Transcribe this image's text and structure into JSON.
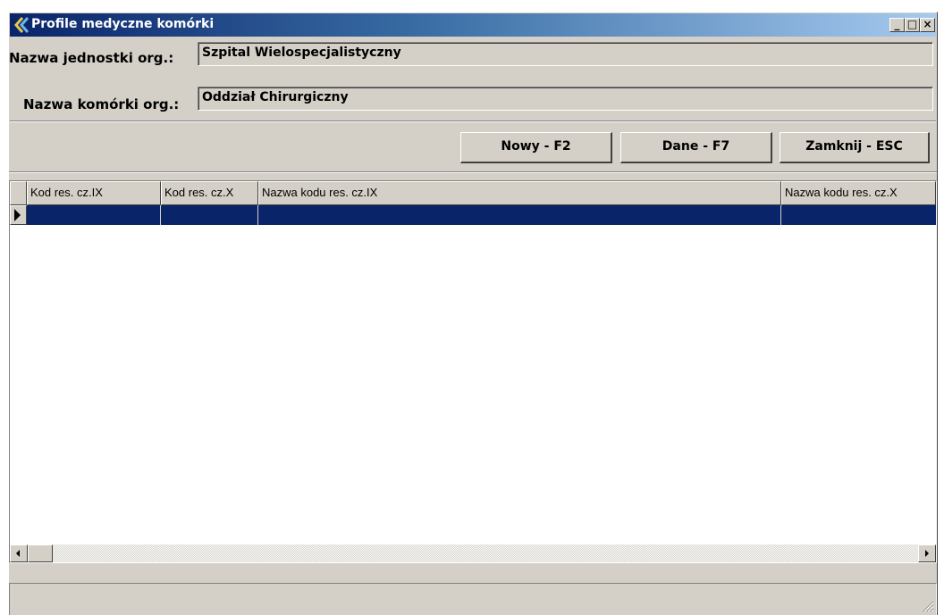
{
  "window": {
    "title": "Profile medyczne komórki",
    "minimize": "_",
    "maximize": "□",
    "close": "×"
  },
  "form": {
    "unit_label": "Nazwa jednostki org.:",
    "unit_value": "Szpital Wielospecjalistyczny",
    "cell_label": "Nazwa komórki org.:",
    "cell_value": "Oddział Chirurgiczny"
  },
  "toolbar": {
    "new_label": "Nowy - F2",
    "data_label": "Dane - F7",
    "close_label": "Zamknij - ESC"
  },
  "grid": {
    "columns": [
      "Kod res. cz.IX",
      "Kod res. cz.X",
      "Nazwa kodu res. cz.IX",
      "Nazwa kodu res. cz.X"
    ],
    "rows": [
      [
        "",
        "",
        "",
        ""
      ]
    ]
  },
  "colors": {
    "selection": "#0a246a",
    "window_bg": "#d4d0c8"
  }
}
